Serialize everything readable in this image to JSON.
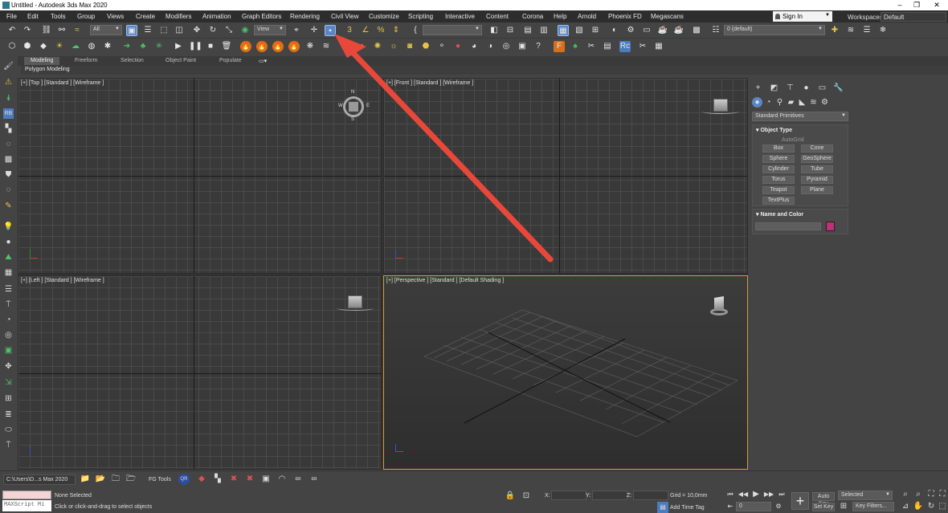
{
  "window": {
    "title": "Untitled - Autodesk 3ds Max 2020",
    "controls": [
      "–",
      "❐",
      "✕"
    ]
  },
  "menu": [
    "File",
    "Edit",
    "Tools",
    "Group",
    "Views",
    "Create",
    "Modifiers",
    "Animation",
    "Graph Editors",
    "Rendering",
    "Civil View",
    "Customize",
    "Scripting",
    "Interactive",
    "Content",
    "Corona",
    "Help",
    "Arnold",
    "Phoenix FD",
    "Megascans"
  ],
  "account": {
    "sign_in": "Sign In",
    "workspaces_label": "Workspaces:",
    "workspace_value": "Default"
  },
  "toolbar": {
    "selection_filter": "All",
    "ref_coord": "View",
    "named_selection": "",
    "layer": "0 (default)"
  },
  "ribbon": {
    "tabs": [
      "Modeling",
      "Freeform",
      "Selection",
      "Object Paint",
      "Populate"
    ],
    "active_tab": "Modeling",
    "panel_label": "Polygon Modeling"
  },
  "viewports": {
    "top": "[+] [Top ] [Standard ] [Wireframe ]",
    "front": "[+] [Front ] [Standard ] [Wireframe ]",
    "left": "[+] [Left ] [Standard ] [Wireframe ]",
    "perspective": "[+] [Perspective ] [Standard ] [Default Shading ]",
    "compass": {
      "n": "N",
      "w": "W",
      "e": "E",
      "s": "S"
    }
  },
  "command_panel": {
    "category": "Standard Primitives",
    "object_type": {
      "title": "Object Type",
      "autogrid": "AutoGrid",
      "buttons": [
        "Box",
        "Cone",
        "Sphere",
        "GeoSphere",
        "Cylinder",
        "Tube",
        "Torus",
        "Pyramid",
        "Teapot",
        "Plane",
        "TextPlus"
      ]
    },
    "name_and_color": {
      "title": "Name and Color",
      "name": "",
      "color": "#c0307a"
    }
  },
  "status": {
    "path": "C:\\Users\\D...s Max 2020",
    "fg_tools": "FG Tools",
    "maxscript": "MAXScript Mi",
    "selection": "None Selected",
    "prompt": "Click or click-and-drag to select objects",
    "x_label": "X:",
    "y_label": "Y:",
    "z_label": "Z:",
    "grid": "Grid = 10,0mm",
    "add_time_tag": "Add Time Tag",
    "frame": "0",
    "auto_key": "Auto Key",
    "set_key": "Set Key",
    "selected": "Selected",
    "key_filters": "Key Filters..."
  },
  "colors": {
    "arrow": "#e8483a",
    "active_viewport_border": "#d0a030",
    "accent": "#5b86c6"
  }
}
